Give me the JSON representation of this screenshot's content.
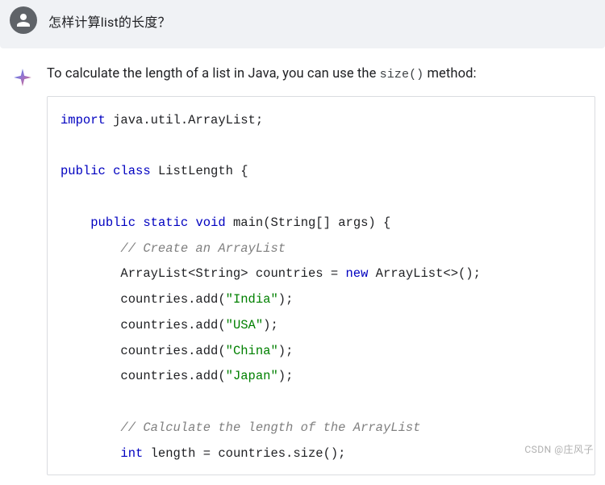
{
  "user": {
    "message": "怎样计算list的长度？"
  },
  "assistant": {
    "intro_pre": "To calculate the length of a list in Java, you can use the ",
    "intro_code": "size()",
    "intro_post": " method:",
    "code": {
      "l1_kw": "import",
      "l1_rest": " java.util.ArrayList;",
      "l3_kw1": "public",
      "l3_kw2": "class",
      "l3_rest": " ListLength {",
      "l5_kw1": "public",
      "l5_kw2": "static",
      "l5_kw3": "void",
      "l5_rest": " main(String[] args) {",
      "l6_comment": "// Create an ArrayList",
      "l7_pre": "        ArrayList<String> countries = ",
      "l7_kw": "new",
      "l7_post": " ArrayList<>();",
      "l8_pre": "        countries.add(",
      "l8_str": "\"India\"",
      "l8_post": ");",
      "l9_pre": "        countries.add(",
      "l9_str": "\"USA\"",
      "l9_post": ");",
      "l10_pre": "        countries.add(",
      "l10_str": "\"China\"",
      "l10_post": ");",
      "l11_pre": "        countries.add(",
      "l11_str": "\"Japan\"",
      "l11_post": ");",
      "l13_comment": "// Calculate the length of the ArrayList",
      "l14_kw": "int",
      "l14_rest": " length = countries.size();"
    }
  },
  "watermark": "CSDN @庄风子"
}
